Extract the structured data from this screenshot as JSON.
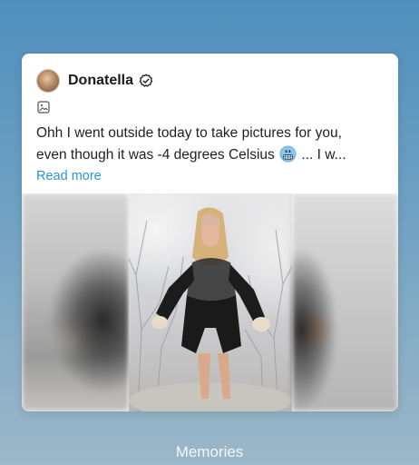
{
  "post": {
    "author": "Donatella",
    "verified": true,
    "text_line1": "Ohh I went outside today to take pictures for you,",
    "text_line2_before_emoji": "even though it was -4 degrees Celsius ",
    "text_line2_after_emoji": " ... I w...",
    "emoji": "cold-face-emoji",
    "read_more": "Read more",
    "media_icon": "image-icon"
  },
  "footer": {
    "label": "Memories"
  },
  "colors": {
    "link": "#2a93d6",
    "card": "#ffffff",
    "text": "#1f1f1f"
  }
}
